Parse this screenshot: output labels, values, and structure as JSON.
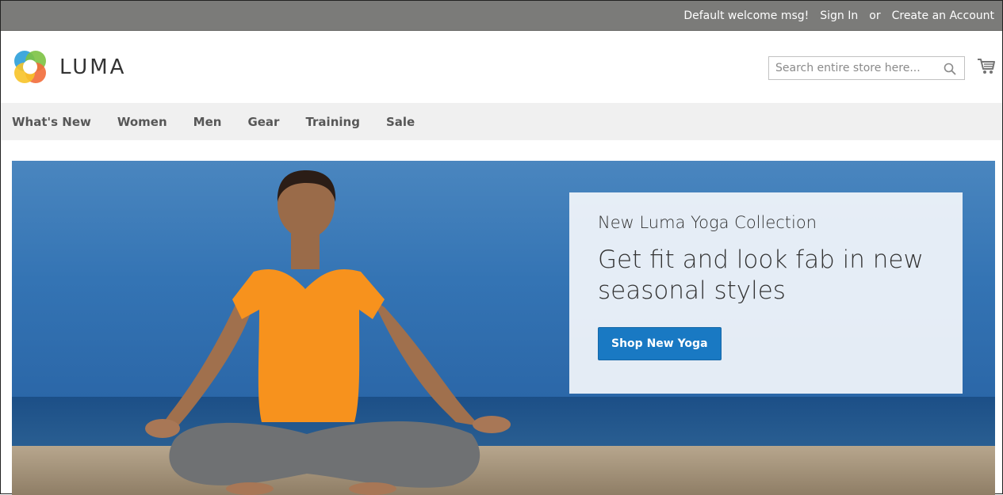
{
  "topbar": {
    "welcome": "Default welcome msg!",
    "sign_in": "Sign In",
    "or": "or",
    "create_account": "Create an Account",
    "bg_color": "#7b7b79"
  },
  "header": {
    "logo_text": "LUMA",
    "search_placeholder": "Search entire store here...",
    "search_icon": "search-icon",
    "cart_icon": "cart-icon"
  },
  "nav": {
    "items": [
      {
        "label": "What's New"
      },
      {
        "label": "Women"
      },
      {
        "label": "Men"
      },
      {
        "label": "Gear"
      },
      {
        "label": "Training"
      },
      {
        "label": "Sale"
      }
    ]
  },
  "hero": {
    "subtitle": "New Luma Yoga Collection",
    "title": "Get fit and look fab in new seasonal styles",
    "button": "Shop New Yoga",
    "accent_color": "#1979c3"
  }
}
